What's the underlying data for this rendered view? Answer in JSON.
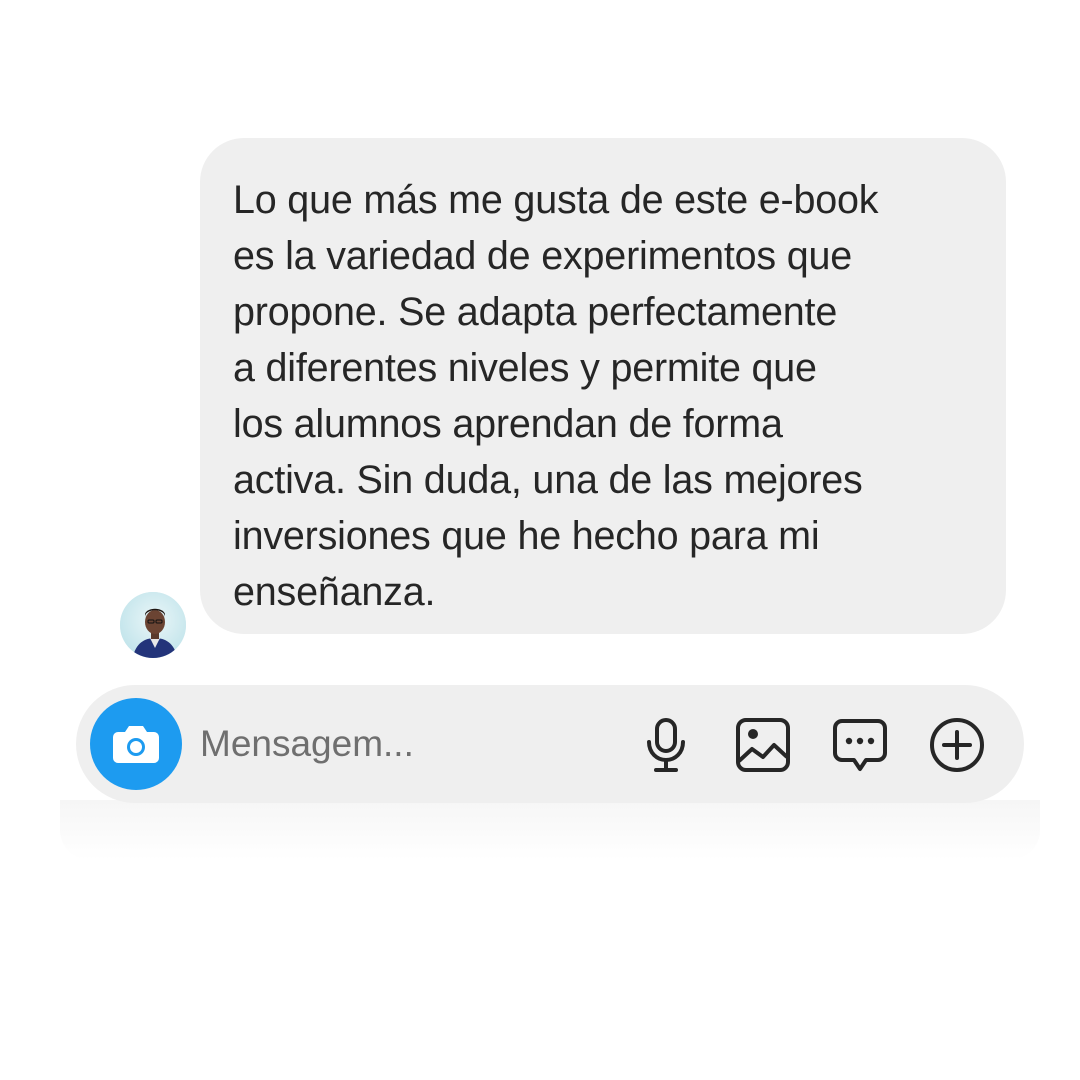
{
  "message": {
    "lines": [
      "Lo que más me gusta de este e-book",
      "es la variedad de experimentos que",
      "propone. Se adapta perfectamente",
      "a diferentes niveles y permite que",
      "los alumnos aprendan de forma",
      "activa. Sin duda, una de las mejores",
      "inversiones que he hecho para mi",
      "enseñanza."
    ]
  },
  "composer": {
    "placeholder": "Mensagem...",
    "icons": {
      "camera": "camera-icon",
      "mic": "microphone-icon",
      "gallery": "image-icon",
      "sticker": "chat-bubble-icon",
      "plus": "plus-circle-icon"
    }
  },
  "colors": {
    "bubble_bg": "#efefef",
    "text": "#262626",
    "accent": "#1d9bf0",
    "placeholder": "#6f6f6f"
  }
}
